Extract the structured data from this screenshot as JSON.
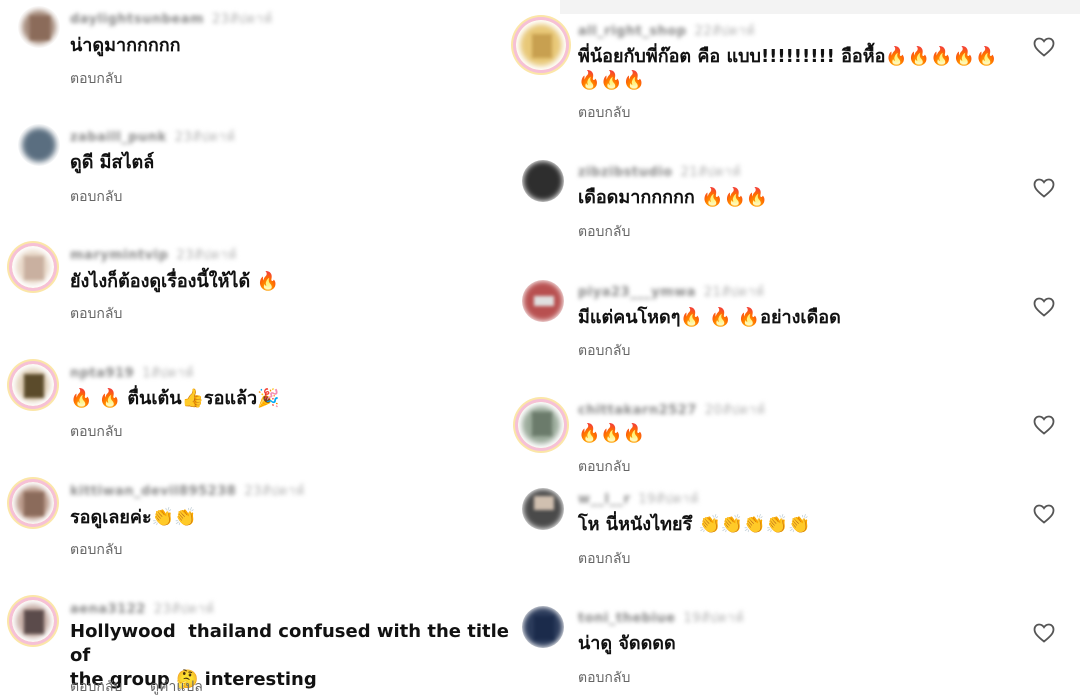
{
  "reply_label": "ตอบกลับ",
  "translate_label": "ดูคำแปล",
  "left_comments": [
    {
      "user": "daylightsunbeam",
      "time": "23สัปดาห์",
      "text": "น่าดูมากกกกก",
      "avatar_color": "#8b6b5a"
    },
    {
      "user": "zabaill_punk",
      "time": "23สัปดาห์",
      "text": "ดูดี มีสไตล์",
      "avatar_color": "#4b5b6b"
    },
    {
      "user": "marymintvip",
      "time": "23สัปดาห์",
      "text": "ยังไงก็ต้องดูเรื่องนี้ให้ได้ 🔥",
      "avatar_color": "#d9c0b0"
    },
    {
      "user": "npta919",
      "time": "1สัปดาห์",
      "text": "🔥 🔥 ตื่นเต้น👍รอแล้ว🎉",
      "avatar_color": "#6b5b3b"
    },
    {
      "user": "kittiwan_devil895238",
      "time": "23สัปดาห์",
      "text": "รอดูเลยค่ะ👏👏",
      "avatar_color": "#9b7b6b"
    },
    {
      "user": "aena3122",
      "time": "23สัปดาห์",
      "text": "Hollywood  thailand confused with the title of\nthe group 🤔 interesting",
      "avatar_color": "#5b4b4b"
    }
  ],
  "right_comments": [
    {
      "user": "all_right_shop",
      "time": "22สัปดาห์",
      "text": "พี่น้อยกับพี่ก๊อต คือ แบบ!!!!!!!!! อือหื้อ🔥🔥🔥🔥🔥\n🔥🔥🔥",
      "avatar_color": "#d8b060"
    },
    {
      "user": "zibzibstudio",
      "time": "21สัปดาห์",
      "text": "เดือดมากกกกก 🔥🔥🔥",
      "avatar_color": "#333333"
    },
    {
      "user": "piya23___ymwa",
      "time": "21สัปดาห์",
      "text": "มีแต่คนโหดๆ🔥 🔥 🔥อย่างเดือด",
      "avatar_color": "#b04040"
    },
    {
      "user": "chittakarn2527",
      "time": "20สัปดาห์",
      "text": "🔥🔥🔥",
      "avatar_color": "#7b8b7b"
    },
    {
      "user": "w__l__r",
      "time": "19สัปดาห์",
      "text": "โห นี่หนังไทยรึ 👏👏👏👏👏",
      "avatar_color": "#3b3b3b"
    },
    {
      "user": "toni_thebiue",
      "time": "19สัปดาห์",
      "text": "น่าดู จัดดดด",
      "avatar_color": "#2b3b5b"
    }
  ],
  "icons": {
    "like": "heart-icon"
  }
}
